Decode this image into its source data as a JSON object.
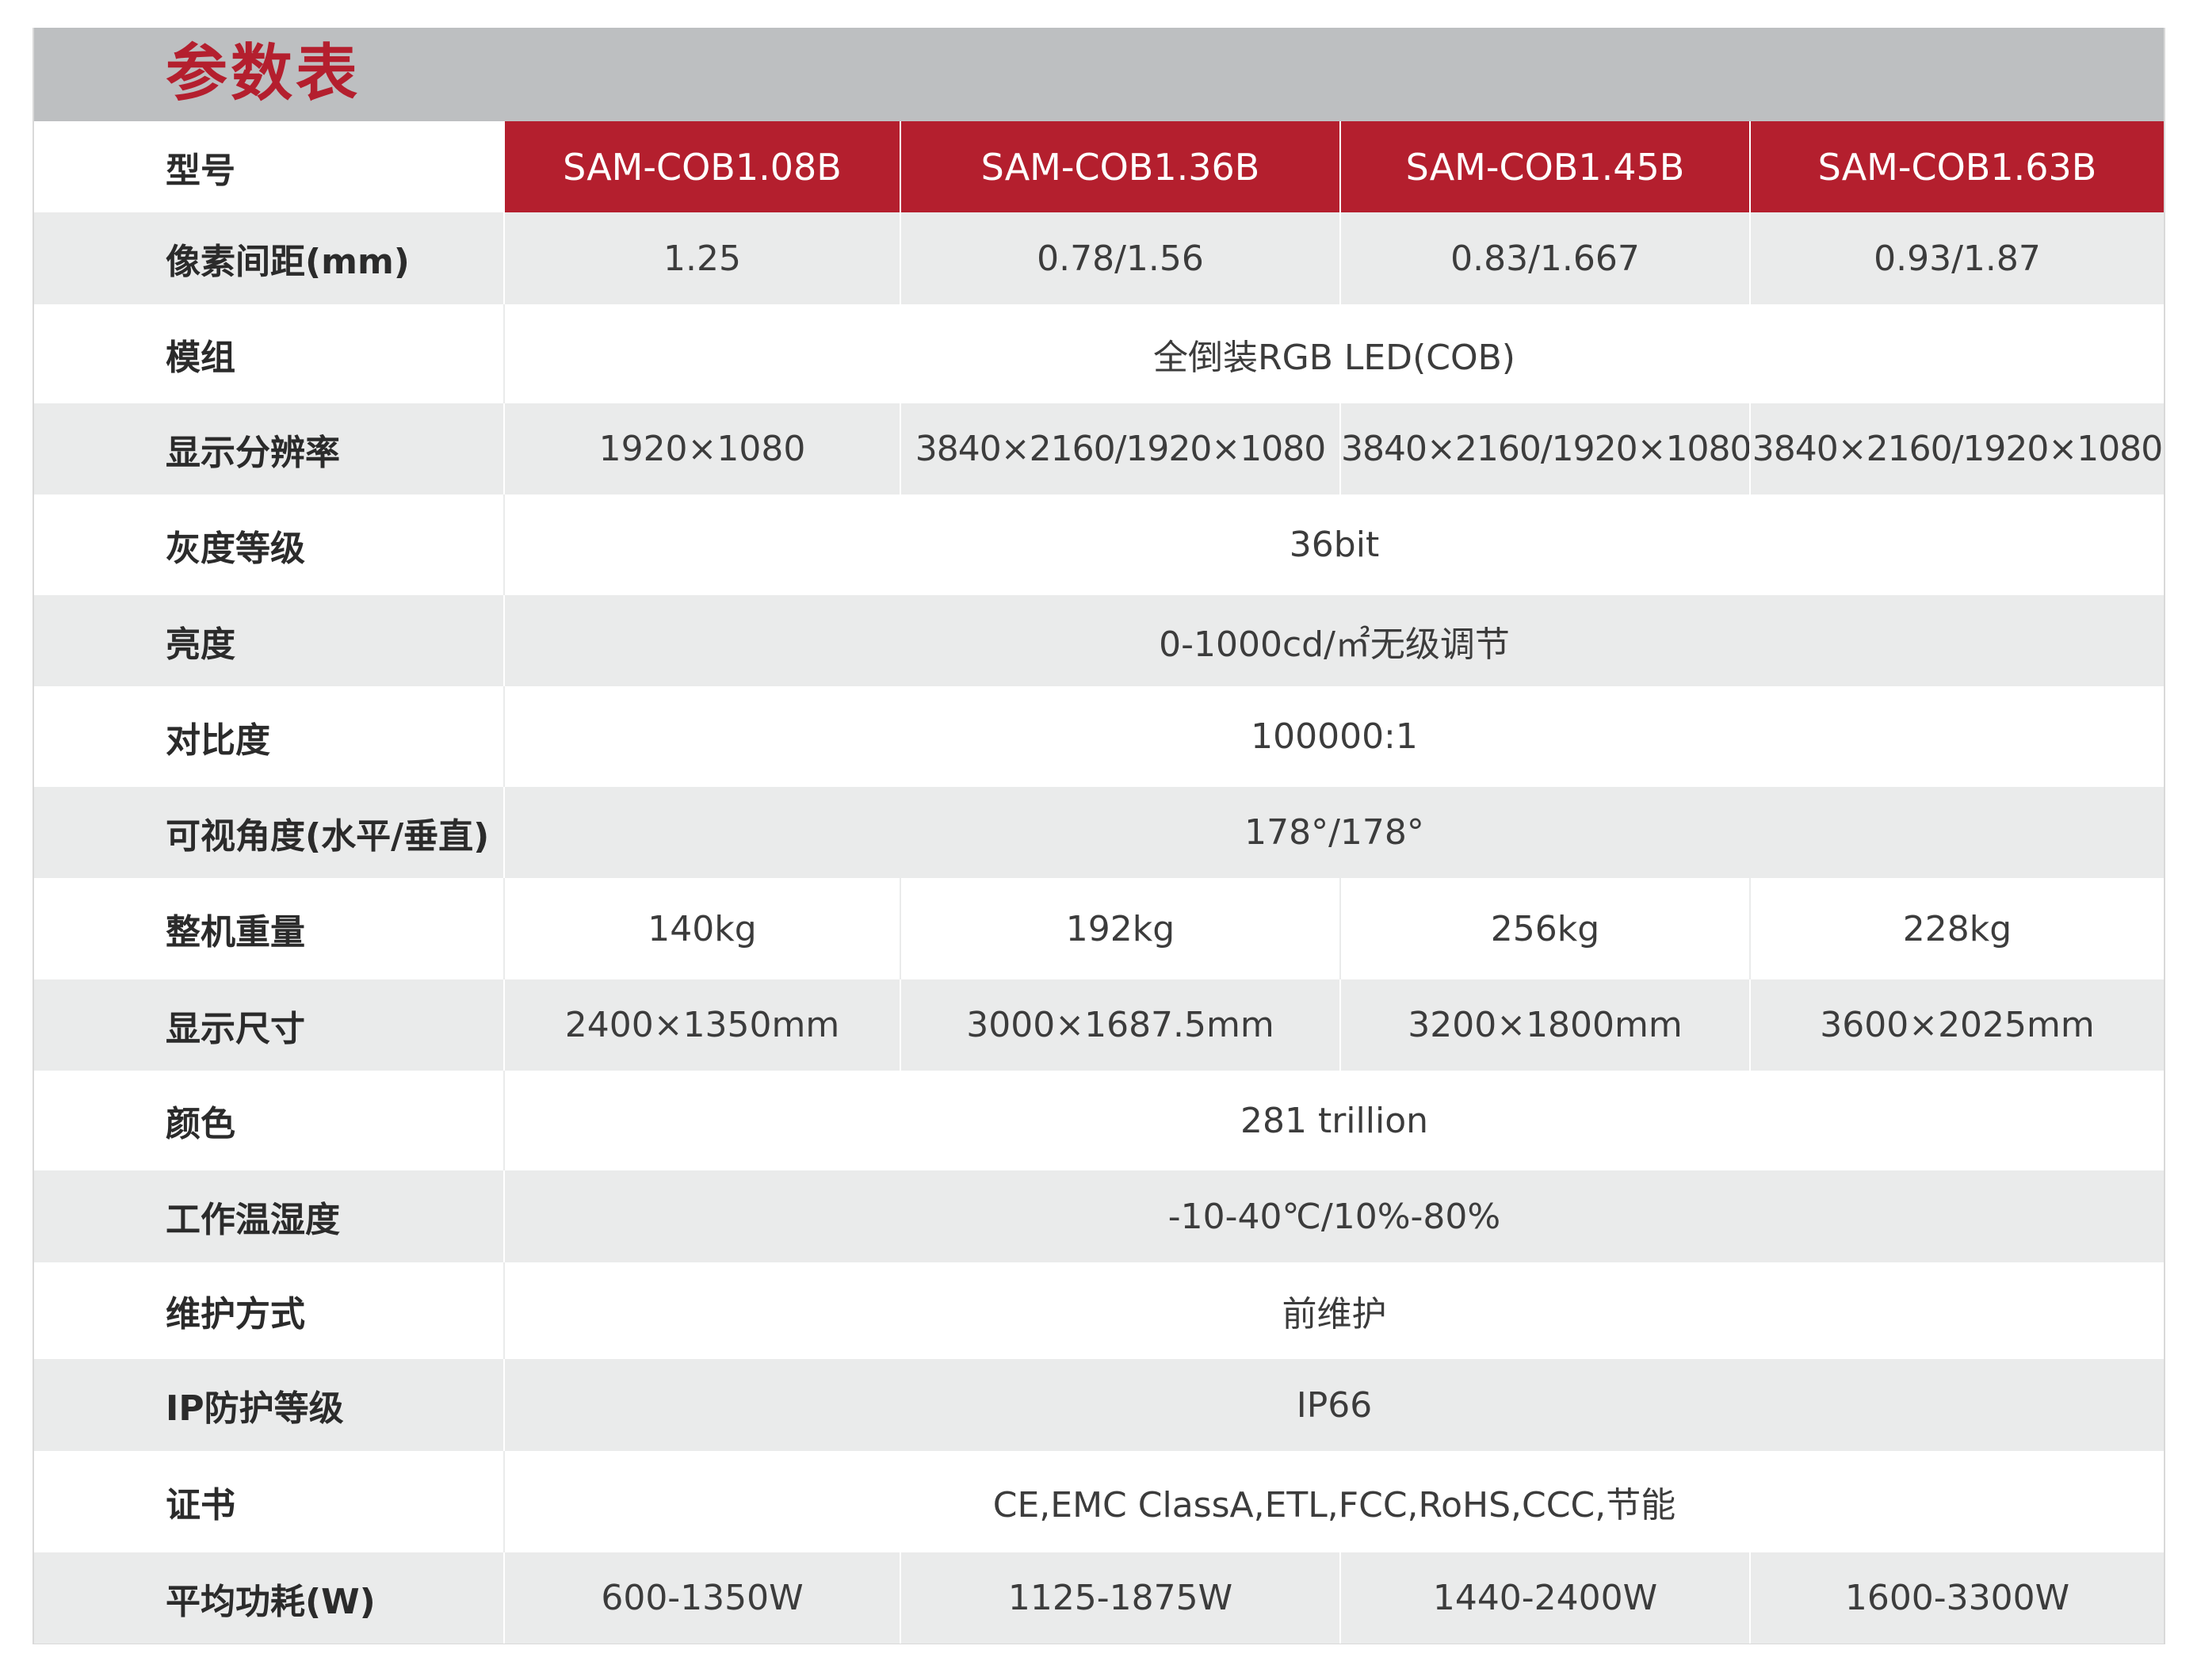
{
  "title": "参数表",
  "model_label": "型号",
  "models": [
    "SAM-COB1.08B",
    "SAM-COB1.36B",
    "SAM-COB1.45B",
    "SAM-COB1.63B"
  ],
  "rows": {
    "pixel_pitch": {
      "label": "像素间距(mm)",
      "values": [
        "1.25",
        "0.78/1.56",
        "0.83/1.667",
        "0.93/1.87"
      ]
    },
    "module": {
      "label": "模组",
      "value": "全倒装RGB LED(COB)"
    },
    "resolution": {
      "label": "显示分辨率",
      "values": [
        "1920×1080",
        "3840×2160/1920×1080",
        "3840×2160/1920×1080",
        "3840×2160/1920×1080"
      ]
    },
    "grayscale": {
      "label": "灰度等级",
      "value": "36bit"
    },
    "brightness": {
      "label": "亮度",
      "value": "0-1000cd/㎡无级调节"
    },
    "contrast": {
      "label": "对比度",
      "value": "100000:1"
    },
    "viewing_angle": {
      "label": "可视角度(水平/垂直)",
      "value": "178°/178°"
    },
    "weight": {
      "label": "整机重量",
      "values": [
        "140kg",
        "192kg",
        "256kg",
        "228kg"
      ]
    },
    "display_size": {
      "label": "显示尺寸",
      "values": [
        "2400×1350mm",
        "3000×1687.5mm",
        "3200×1800mm",
        "3600×2025mm"
      ]
    },
    "color": {
      "label": "颜色",
      "value": "281 trillion"
    },
    "operating_env": {
      "label": "工作温湿度",
      "value": "-10-40℃/10%-80%"
    },
    "maintenance": {
      "label": "维护方式",
      "value": "前维护"
    },
    "ip_rating": {
      "label": "IP防护等级",
      "value": "IP66"
    },
    "certificates": {
      "label": "证书",
      "value": "CE,EMC ClassA,ETL,FCC,RoHS,CCC,节能"
    },
    "power": {
      "label": "平均功耗(W)",
      "values": [
        "600-1350W",
        "1125-1875W",
        "1440-2400W",
        "1600-3300W"
      ]
    }
  },
  "colors": {
    "accent_red": "#b41f2e",
    "title_bar_grey": "#bdbfc1",
    "row_grey": "#eaebeb"
  }
}
